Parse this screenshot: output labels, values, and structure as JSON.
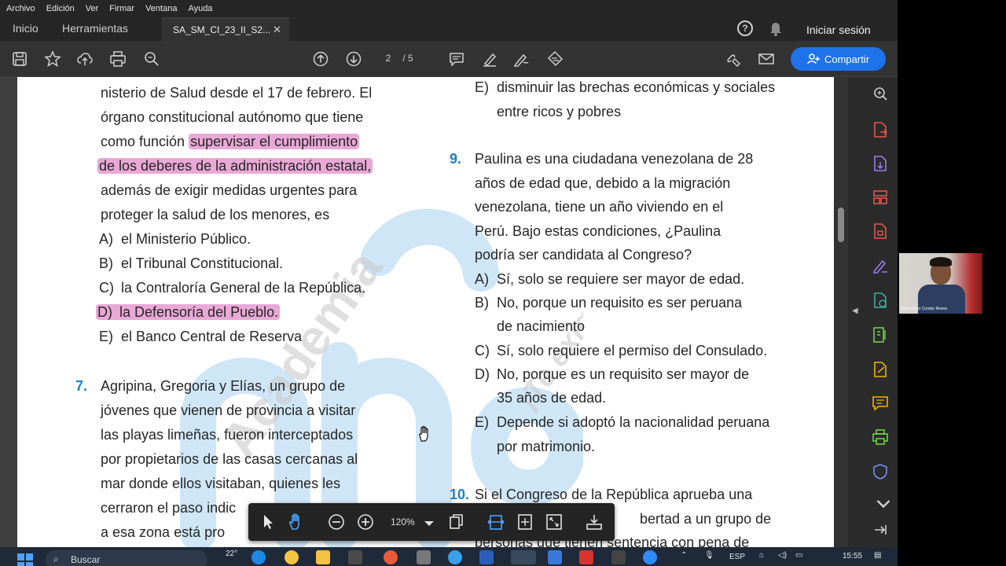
{
  "menu": [
    "Archivo",
    "Edición",
    "Ver",
    "Firmar",
    "Ventana",
    "Ayuda"
  ],
  "tabs": {
    "home": "Inicio",
    "tools": "Herramientas",
    "document": "SA_SM_CI_23_II_S2...",
    "signin": "Iniciar sesión"
  },
  "toolbar": {
    "page_current": "2",
    "page_total": "/ 5",
    "share_label": "Compartir"
  },
  "floating_toolbar": {
    "zoom": "120%"
  },
  "document": {
    "left_column": {
      "intro_lines": [
        "nisterio de Salud desde el 17 de febrero. El",
        "órgano constitucional autónomo que tiene",
        "como función",
        "supervisar el cumplimiento",
        "de los deberes de la administración estatal,",
        "además de exigir medidas urgentes para",
        "proteger la salud de los menores, es"
      ],
      "options": [
        {
          "letter": "A)",
          "text": "el Ministerio Público."
        },
        {
          "letter": "B)",
          "text": "el Tribunal Constitucional."
        },
        {
          "letter": "C)",
          "text": "la Contraloría General de la República."
        },
        {
          "letter": "D)",
          "text": "la Defensoría del Pueblo."
        },
        {
          "letter": "E)",
          "text": "el Banco Central de Reserva"
        }
      ],
      "q7": {
        "number": "7.",
        "lines": [
          "Agripina, Gregoria y Elías, un grupo de",
          "jóvenes que vienen de provincia a visitar",
          "las playas limeñas, fueron interceptados",
          "por propietarios de las casas cercanas al",
          "mar donde ellos visitaban, quienes les",
          "cerraron el paso indic",
          "a esa zona está pro"
        ]
      }
    },
    "right_column": {
      "prev_option": {
        "letter": "E)",
        "lines": [
          "disminuir las brechas económicas y sociales",
          "entre ricos y pobres"
        ]
      },
      "q9": {
        "number": "9.",
        "lines": [
          "Paulina es una ciudadana venezolana de 28",
          "años de edad que, debido a la migración",
          "venezolana, tiene un año viviendo en el",
          "Perú. Bajo estas condiciones, ¿Paulina",
          "podría ser candidata al Congreso?"
        ],
        "options": [
          {
            "letter": "A)",
            "lines": [
              "Sí, solo se requiere ser mayor de edad."
            ]
          },
          {
            "letter": "B)",
            "lines": [
              "No, porque un requisito es ser peruana",
              "de nacimiento"
            ]
          },
          {
            "letter": "C)",
            "lines": [
              "Sí, solo requiere el permiso del Consulado."
            ]
          },
          {
            "letter": "D)",
            "lines": [
              "No, porque es un requisito ser mayor de",
              "35 años de edad."
            ]
          },
          {
            "letter": "E)",
            "lines": [
              "Depende si adoptó la nacionalidad peruana",
              "por matrimonio."
            ]
          }
        ]
      },
      "q10": {
        "number": "10.",
        "lines": [
          "Si el Congreso de la República aprueba una",
          "bertad a un grupo de",
          "personas que tienen sentencia con pena de"
        ]
      }
    },
    "watermark": {
      "line1": "Academia",
      "line2": "¡Te exigimos más!"
    }
  },
  "webcam": {
    "name": "Juan Víctor Condor Rivera"
  },
  "taskbar": {
    "search": "Buscar",
    "temp": "22°",
    "lang": "ESP",
    "time": "15:55"
  },
  "colors": {
    "accent": "#1f73e8",
    "highlight": "#e9a8d6",
    "question_number": "#1f7fc3"
  }
}
